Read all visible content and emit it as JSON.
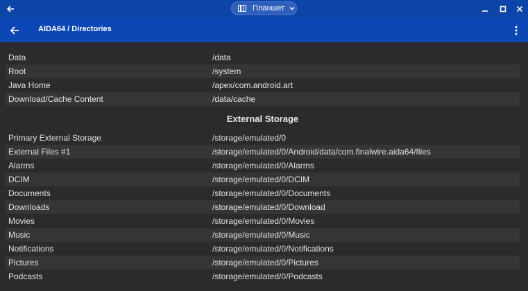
{
  "window": {
    "mode_label": "Планшет"
  },
  "appbar": {
    "title": "AIDA64  /  Directories"
  },
  "directories": [
    {
      "label": "Data",
      "path": "/data"
    },
    {
      "label": "Root",
      "path": "/system"
    },
    {
      "label": "Java Home",
      "path": "/apex/com.android.art"
    },
    {
      "label": "Download/Cache Content",
      "path": "/data/cache"
    }
  ],
  "external_storage": {
    "header": "External Storage",
    "rows": [
      {
        "label": "Primary External Storage",
        "path": "/storage/emulated/0"
      },
      {
        "label": "External Files #1",
        "path": "/storage/emulated/0/Android/data/com.finalwire.aida64/files"
      },
      {
        "label": "Alarms",
        "path": "/storage/emulated/0/Alarms"
      },
      {
        "label": "DCIM",
        "path": "/storage/emulated/0/DCIM"
      },
      {
        "label": "Documents",
        "path": "/storage/emulated/0/Documents"
      },
      {
        "label": "Downloads",
        "path": "/storage/emulated/0/Download"
      },
      {
        "label": "Movies",
        "path": "/storage/emulated/0/Movies"
      },
      {
        "label": "Music",
        "path": "/storage/emulated/0/Music"
      },
      {
        "label": "Notifications",
        "path": "/storage/emulated/0/Notifications"
      },
      {
        "label": "Pictures",
        "path": "/storage/emulated/0/Pictures"
      },
      {
        "label": "Podcasts",
        "path": "/storage/emulated/0/Podcasts"
      }
    ]
  },
  "colors": {
    "titlebar": "#0c44a8",
    "appbar": "#0d47b5",
    "background": "#2b2b2b",
    "row_alt": "#353535"
  }
}
